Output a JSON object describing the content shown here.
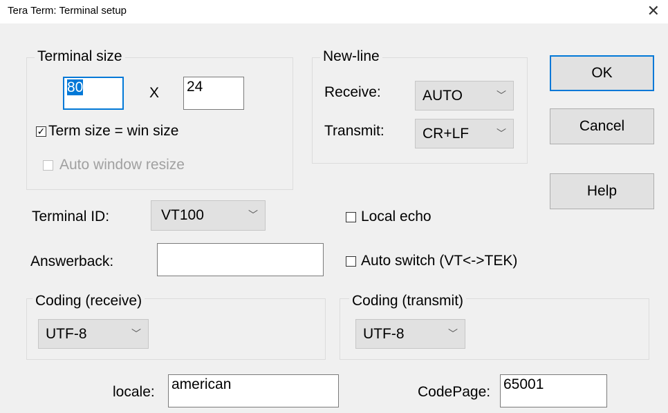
{
  "window": {
    "title": "Tera Term: Terminal setup"
  },
  "terminal_size": {
    "label": "Terminal size",
    "cols": "80",
    "separator": "X",
    "rows": "24",
    "term_size_label": "Term size = win size",
    "term_size_checked": true,
    "auto_resize_label": "Auto window resize",
    "auto_resize_checked": false
  },
  "new_line": {
    "label": "New-line",
    "receive_label": "Receive:",
    "receive_value": "AUTO",
    "transmit_label": "Transmit:",
    "transmit_value": "CR+LF"
  },
  "buttons": {
    "ok": "OK",
    "cancel": "Cancel",
    "help": "Help"
  },
  "terminal_id": {
    "label": "Terminal ID:",
    "value": "VT100"
  },
  "local_echo": {
    "label": "Local echo",
    "checked": false
  },
  "answerback": {
    "label": "Answerback:",
    "value": ""
  },
  "auto_switch": {
    "label": "Auto switch (VT<->TEK)",
    "checked": false
  },
  "coding_receive": {
    "label": "Coding (receive)",
    "value": "UTF-8"
  },
  "coding_transmit": {
    "label": "Coding (transmit)",
    "value": "UTF-8"
  },
  "locale": {
    "label": "locale:",
    "value": "american"
  },
  "codepage": {
    "label": "CodePage:",
    "value": "65001"
  }
}
